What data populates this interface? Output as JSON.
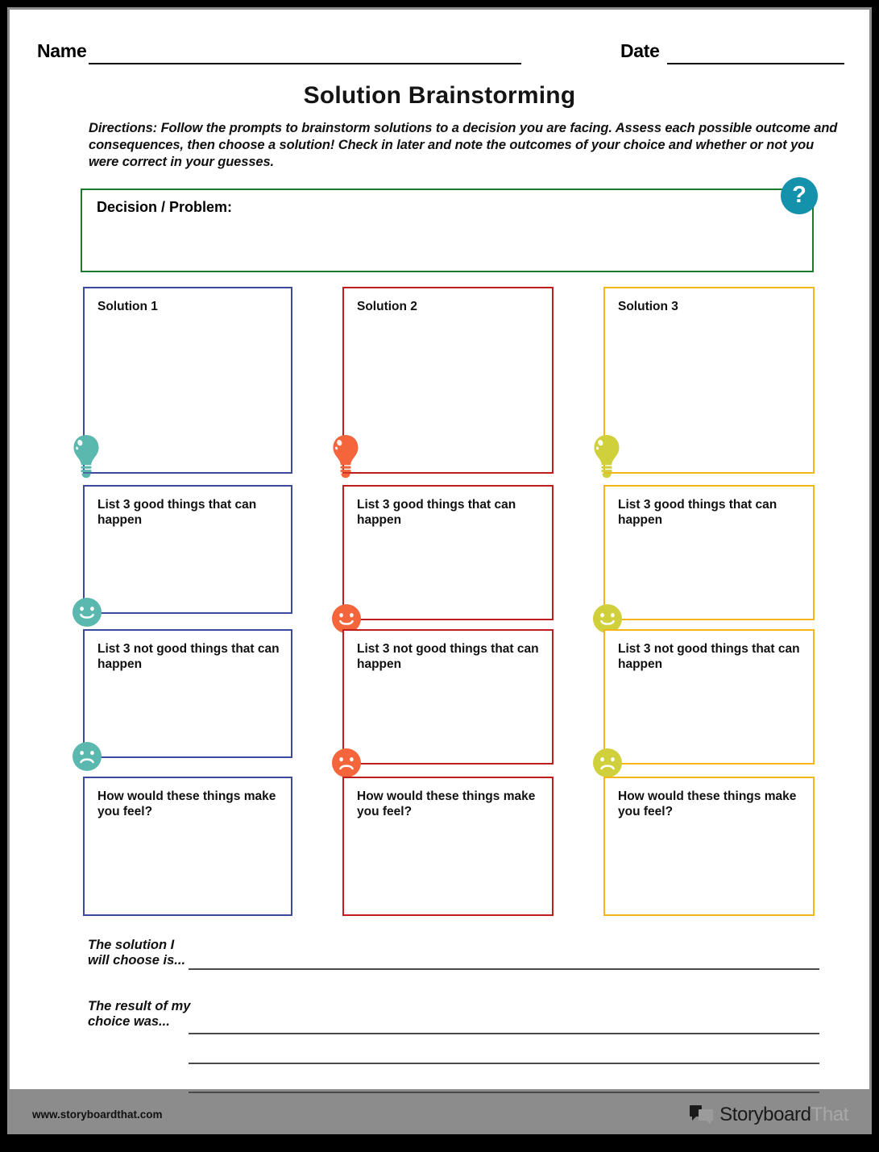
{
  "header": {
    "name_label": "Name",
    "date_label": "Date"
  },
  "title": "Solution Brainstorming",
  "directions": "Directions: Follow the prompts to brainstorm solutions to a decision you are facing. Assess each possible outcome and consequences, then choose a solution! Check in later and note the outcomes of your choice and whether or not you were correct in your guesses.",
  "decision": {
    "label": "Decision / Problem:",
    "help_glyph": "?",
    "border_color": "#1a7a2e",
    "help_color": "#1592ab"
  },
  "columns": [
    {
      "border_color": "#3b4a9c",
      "icon_color": "#5bb8ae",
      "cells": [
        {
          "title": "Solution 1",
          "icon": "lightbulb-icon"
        },
        {
          "title": "List 3 good things that can happen",
          "icon": "smiley-face-icon"
        },
        {
          "title": "List 3 not good things that can happen",
          "icon": "frowny-face-icon"
        },
        {
          "title": "How would these things make you feel?",
          "icon": ""
        }
      ]
    },
    {
      "border_color": "#c11d1d",
      "icon_color": "#f4653c",
      "cells": [
        {
          "title": "Solution 2",
          "icon": "lightbulb-icon"
        },
        {
          "title": "List 3 good things that can happen",
          "icon": "smiley-face-icon"
        },
        {
          "title": "List 3 not good things that can happen",
          "icon": "frowny-face-icon"
        },
        {
          "title": "How would these things make you feel?",
          "icon": ""
        }
      ]
    },
    {
      "border_color": "#f4b41a",
      "icon_color": "#cfd03c",
      "cells": [
        {
          "title": "Solution 3",
          "icon": "lightbulb-icon"
        },
        {
          "title": "List 3 good things that can happen",
          "icon": "smiley-face-icon"
        },
        {
          "title": "List 3 not good things that can happen",
          "icon": "frowny-face-icon"
        },
        {
          "title": "How would these things make you feel?",
          "icon": ""
        }
      ]
    }
  ],
  "bottom_prompts": [
    {
      "label": "The solution I will choose is...",
      "lines": 1
    },
    {
      "label": "The result of my choice was...",
      "lines": 3
    }
  ],
  "footer": {
    "url": "www.storyboardthat.com",
    "logo_dark": "Storyboard",
    "logo_light": "That"
  }
}
